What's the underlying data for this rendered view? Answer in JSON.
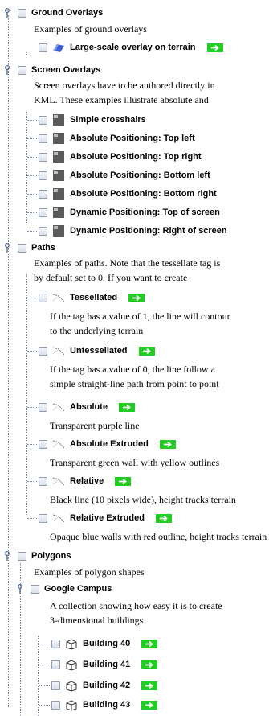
{
  "colors": {
    "accent_green": "#22cc22",
    "tree_line": "#7a8ea8",
    "checkbox_border": "#8f9bae"
  },
  "tree": {
    "ground": {
      "title": "Ground Overlays",
      "description": "Examples of ground overlays",
      "items": [
        {
          "label": "Large-scale overlay on terrain",
          "icon": "ground-overlay-icon"
        }
      ]
    },
    "screen": {
      "title": "Screen Overlays",
      "description_line1": "Screen overlays have to be authored directly in",
      "description_line2": "KML. These examples illustrate absolute and",
      "items": [
        {
          "label": "Simple crosshairs",
          "icon": "screen-overlay-icon"
        },
        {
          "label": "Absolute Positioning: Top left",
          "icon": "screen-overlay-icon"
        },
        {
          "label": "Absolute Positioning: Top right",
          "icon": "screen-overlay-icon"
        },
        {
          "label": "Absolute Positioning: Bottom left",
          "icon": "screen-overlay-icon"
        },
        {
          "label": "Absolute Positioning: Bottom right",
          "icon": "screen-overlay-icon"
        },
        {
          "label": "Dynamic Positioning: Top of screen",
          "icon": "screen-overlay-icon"
        },
        {
          "label": "Dynamic Positioning: Right of screen",
          "icon": "screen-overlay-icon"
        }
      ]
    },
    "paths": {
      "title": "Paths",
      "description_line1": "Examples of paths. Note that the tessellate tag is",
      "description_line2": "by default set to 0. If you want to create",
      "items": [
        {
          "label": "Tessellated",
          "icon": "path-icon",
          "desc1": "If the  tag has a value of 1, the line will contour",
          "desc2": "to the underlying terrain"
        },
        {
          "label": "Untessellated",
          "icon": "path-icon",
          "desc1": "If the  tag has a value of 0, the line follow a",
          "desc2": "simple straight-line path from point to point"
        },
        {
          "label": "Absolute",
          "icon": "path-icon",
          "desc1": "Transparent purple line"
        },
        {
          "label": "Absolute Extruded",
          "icon": "path-icon",
          "desc1": "Transparent green wall with yellow outlines"
        },
        {
          "label": "Relative",
          "icon": "path-icon",
          "desc1": "Black line (10 pixels wide), height tracks terrain"
        },
        {
          "label": "Relative Extruded",
          "icon": "path-icon",
          "desc1": "Opaque blue walls with red outline, height tracks terrain"
        }
      ]
    },
    "polygons": {
      "title": "Polygons",
      "description": "Examples of polygon shapes",
      "campus": {
        "title": "Google Campus",
        "description_line1": "A collection showing how easy it is to create",
        "description_line2": "3-dimensional buildings",
        "items": [
          {
            "label": "Building 40",
            "icon": "building-icon"
          },
          {
            "label": "Building 41",
            "icon": "building-icon"
          },
          {
            "label": "Building 42",
            "icon": "building-icon"
          },
          {
            "label": "Building 43",
            "icon": "building-icon"
          }
        ]
      }
    }
  }
}
